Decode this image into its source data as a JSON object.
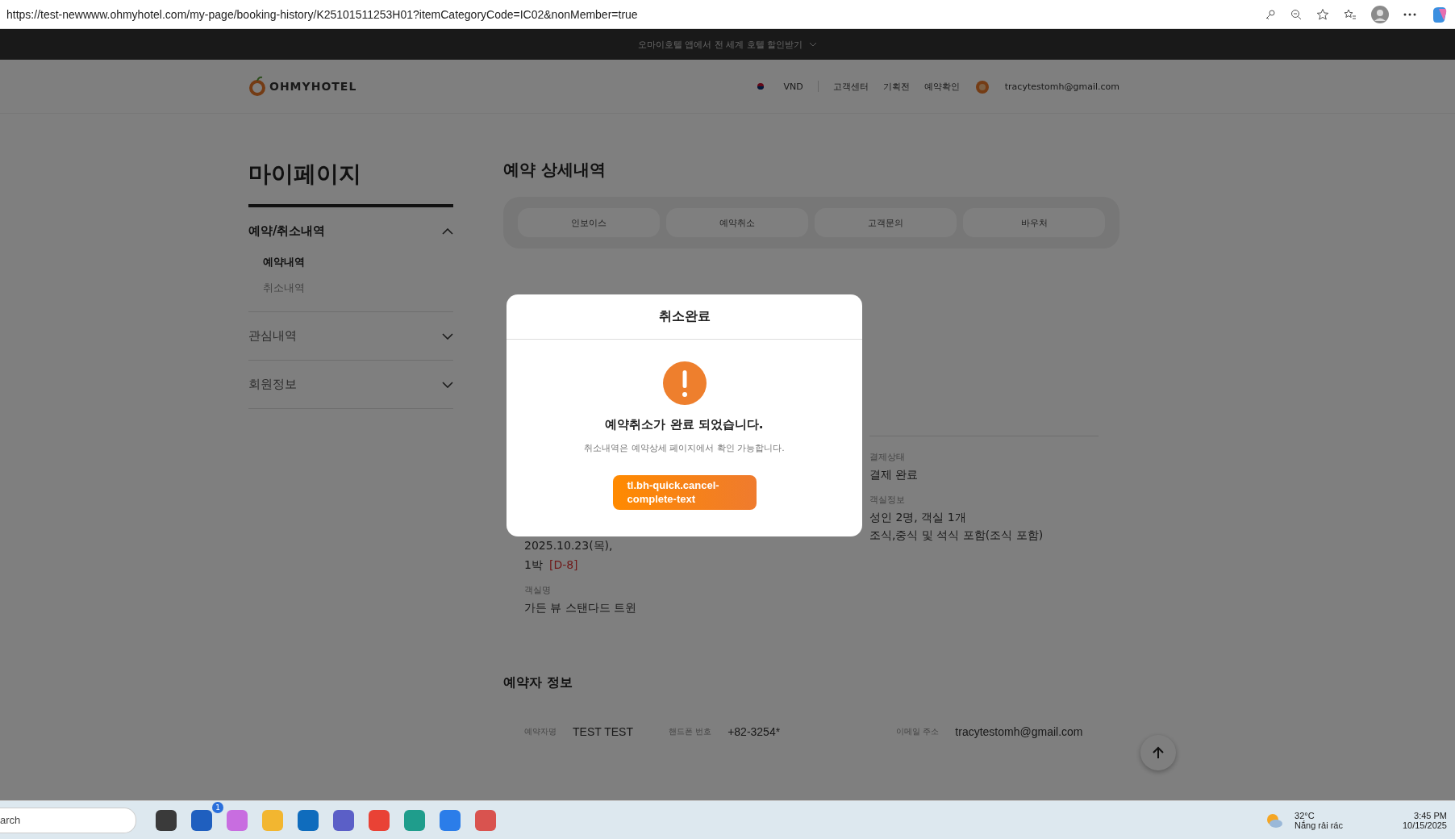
{
  "browser": {
    "url": "https://test-newwww.ohmyhotel.com/my-page/booking-history/K25101511253H01?itemCategoryCode=IC02&nonMember=true"
  },
  "banner": {
    "text": "오마이호텔 앱에서 전 세계 호텔 할인받기"
  },
  "header": {
    "logo": "OHMYHOTEL",
    "currency": "VND",
    "links": [
      "고객센터",
      "기획전",
      "예약확인"
    ],
    "email": "tracytestomh@gmail.com"
  },
  "sidebar": {
    "title": "마이페이지",
    "sections": [
      {
        "label": "예약/취소내역",
        "expanded": true,
        "children": [
          {
            "label": "예약내역",
            "selected": true
          },
          {
            "label": "취소내역",
            "selected": false
          }
        ]
      },
      {
        "label": "관심내역",
        "expanded": false
      },
      {
        "label": "회원정보",
        "expanded": false
      }
    ]
  },
  "main": {
    "title": "예약 상세내역",
    "tabs": [
      "인보이스",
      "예약취소",
      "고객문의",
      "바우처"
    ],
    "details_left": [
      {
        "value": "2025.10.23(목),"
      },
      {
        "value": "1박",
        "tag": "[D-8]"
      },
      {
        "label": "객실명",
        "value": "가든 뷰 스탠다드 트윈"
      }
    ],
    "details_right": [
      {
        "label": "결제상태",
        "value": "결제 완료"
      },
      {
        "label": "객실정보",
        "value": "성인 2명, 객실 1개",
        "extra": "조식,중식 및 석식 포함(조식 포함)"
      }
    ],
    "booker": {
      "title": "예약자 정보",
      "fields": [
        {
          "label": "예약자명",
          "value": "TEST TEST"
        },
        {
          "label": "핸드폰 번호",
          "value": "+82-3254*"
        },
        {
          "label": "이메일 주소",
          "value": "tracytestomh@gmail.com"
        }
      ]
    }
  },
  "modal": {
    "title": "취소완료",
    "message": "예약취소가 완료 되었습니다.",
    "sub": "취소내역은 예약상세 페이지에서 확인 가능합니다.",
    "button": "tl.bh-quick.cancel-complete-text"
  },
  "taskbar": {
    "search": "arch",
    "apps": [
      {
        "color": "#3a3a3a"
      },
      {
        "color": "#1f5fbf",
        "badge": "1"
      },
      {
        "color": "#c86de0"
      },
      {
        "color": "#f2b630"
      },
      {
        "color": "#0f6cbd"
      },
      {
        "color": "#5b5fc7"
      },
      {
        "color": "#e94235"
      },
      {
        "color": "#1f9d8c"
      },
      {
        "color": "#2b7de9"
      },
      {
        "color": "#d9534f"
      }
    ],
    "temp": "32°C",
    "weather": "Nắng rải rác",
    "time": "3:45 PM",
    "date": "10/15/2025"
  }
}
